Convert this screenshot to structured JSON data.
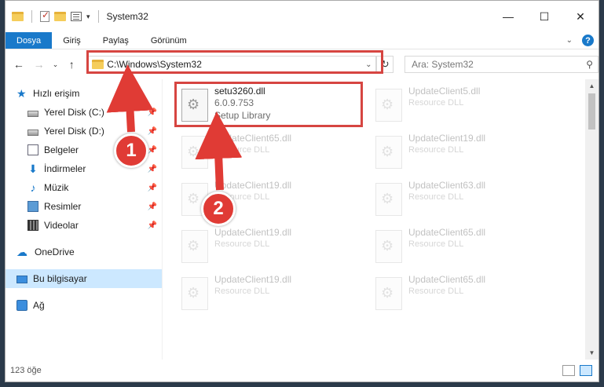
{
  "window": {
    "title": "System32"
  },
  "ribbon": {
    "tabs": [
      "Dosya",
      "Giriş",
      "Paylaş",
      "Görünüm"
    ],
    "active_tab": "Dosya"
  },
  "navigation": {
    "address": "C:\\Windows\\System32",
    "search_placeholder": "Ara: System32"
  },
  "sidebar": {
    "quick_access": "Hızlı erişim",
    "items": [
      {
        "label": "Yerel Disk (C:)",
        "icon": "drive-icon"
      },
      {
        "label": "Yerel Disk (D:)",
        "icon": "drive-icon"
      },
      {
        "label": "Belgeler",
        "icon": "documents-icon"
      },
      {
        "label": "İndirmeler",
        "icon": "downloads-icon"
      },
      {
        "label": "Müzik",
        "icon": "music-icon"
      },
      {
        "label": "Resimler",
        "icon": "pictures-icon"
      },
      {
        "label": "Videolar",
        "icon": "videos-icon"
      }
    ],
    "onedrive": "OneDrive",
    "this_pc": "Bu bilgisayar",
    "network": "Ağ"
  },
  "files": [
    {
      "name": "setu3260.dll",
      "version": "6.0.9.753",
      "description": "Setup Library",
      "highlighted": true
    },
    {
      "name": "UpdateClient5.dll",
      "description": "Resource DLL"
    },
    {
      "name": "UpdateClient65.dll",
      "description": "Resource DLL"
    },
    {
      "name": "UpdateClient19.dll",
      "description": "Resource DLL"
    },
    {
      "name": "UpdateClient19.dll",
      "description": "Resource DLL"
    },
    {
      "name": "UpdateClient63.dll",
      "description": "Resource DLL"
    },
    {
      "name": "UpdateClient19.dll",
      "description": "Resource DLL"
    },
    {
      "name": "UpdateClient65.dll",
      "description": "Resource DLL"
    },
    {
      "name": "UpdateClient19.dll",
      "description": "Resource DLL"
    },
    {
      "name": "UpdateClient65.dll",
      "description": "Resource DLL"
    }
  ],
  "status": {
    "item_count": "123 öğe"
  },
  "annotations": {
    "step1": "1",
    "step2": "2",
    "color": "#e03b35"
  }
}
